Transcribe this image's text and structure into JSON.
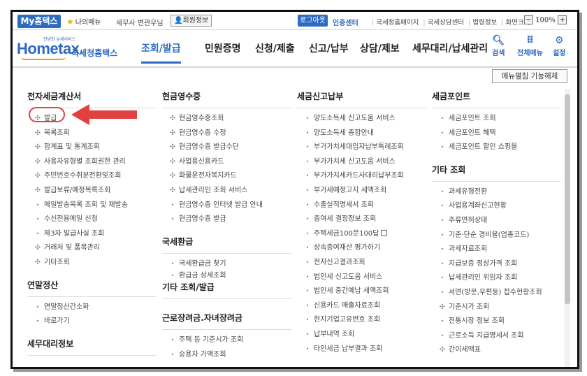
{
  "topbar": {
    "my_hometax": "My홈택스",
    "my_menu": "나의메뉴",
    "username": "세무사 변관우님",
    "member_info": "회원정보",
    "logout": "로그아웃",
    "cert_center": "인증센터",
    "links": [
      "국세청홈페이지",
      "국세상담센터",
      "법령정보",
      "화면크기"
    ],
    "zoom_minus": "−",
    "zoom_level": "100%",
    "zoom_plus": "+"
  },
  "logo": {
    "text": "Hometax.",
    "sub": "국세청홈택스",
    "tiny": "안녕한 납세서비스"
  },
  "nav": {
    "items": [
      "조회/발급",
      "민원증명",
      "신청/제출",
      "신고/납부",
      "상담/제보",
      "세무대리/납세관리"
    ],
    "active_index": 0
  },
  "util": {
    "search": "검색",
    "all_menu": "전체메뉴",
    "settings": "설정"
  },
  "menu_toggle": "메뉴펼침 기능해제",
  "columns": [
    {
      "sections": [
        {
          "title": "전자세금계산서",
          "items": [
            {
              "label": "발급",
              "mark": "✣"
            },
            {
              "label": "목록조회",
              "mark": "✣"
            },
            {
              "label": "합계표 및 통계조회",
              "mark": "✣"
            },
            {
              "label": "사용자유형별 조회권한 관리",
              "mark": "✣"
            },
            {
              "label": "주민번호수취분전환및조회",
              "mark": "✣"
            },
            {
              "label": "발급보류/예정목록조회",
              "mark": "✣"
            },
            {
              "label": "메일발송목록 조회 및 재발송",
              "mark": "•"
            },
            {
              "label": "수신전용메일 신청",
              "mark": "•"
            },
            {
              "label": "제3자 발급사실 조회",
              "mark": "•"
            },
            {
              "label": "거래처 및 품목관리",
              "mark": "✣"
            },
            {
              "label": "기타조회",
              "mark": "✣"
            }
          ]
        },
        {
          "title": "연말정산",
          "items": [
            {
              "label": "연말정산간소화",
              "mark": "•"
            },
            {
              "label": "바로가기",
              "mark": "•"
            }
          ]
        },
        {
          "title": "세무대리정보",
          "items": []
        }
      ]
    },
    {
      "sections": [
        {
          "title": "현금영수증",
          "items": [
            {
              "label": "현금영수증조회",
              "mark": "✣"
            },
            {
              "label": "현금영수증 수정",
              "mark": "✣"
            },
            {
              "label": "현금영수증 발급수단",
              "mark": "✣"
            },
            {
              "label": "사업용신용카드",
              "mark": "✣"
            },
            {
              "label": "화물운전자복지카드",
              "mark": "✣"
            },
            {
              "label": "납세관리인 조회 서비스",
              "mark": "✣"
            },
            {
              "label": "현금영수증 인터넷 발급 안내",
              "mark": "•"
            },
            {
              "label": "현금영수증 발급",
              "mark": "•"
            }
          ]
        },
        {
          "title": "국세환급",
          "items": [
            {
              "label": "국세환급금 찾기",
              "mark": "•"
            },
            {
              "label": "환급금 상세조회",
              "mark": "•"
            }
          ]
        },
        {
          "title": "기타 조회/발급",
          "items": []
        },
        {
          "title": "근로장려금.자녀장려금",
          "items": [
            {
              "label": "주택 등 기준시가 조회",
              "mark": "•"
            },
            {
              "label": "승용차 가액조회",
              "mark": "•"
            }
          ]
        }
      ]
    },
    {
      "sections": [
        {
          "title": "세금신고납부",
          "items": [
            {
              "label": "양도소득세 신고도움 서비스",
              "mark": "•"
            },
            {
              "label": "양도소득세 종합안내",
              "mark": "•"
            },
            {
              "label": "부가가치세대입자납부특례조회",
              "mark": "•"
            },
            {
              "label": "부가가치세 신고도움 서비스",
              "mark": "•"
            },
            {
              "label": "부가가치세카드사대리납부조회",
              "mark": "•"
            },
            {
              "label": "부가세예정고지 세액조회",
              "mark": "•"
            },
            {
              "label": "수출실적명세서 조회",
              "mark": "•"
            },
            {
              "label": "증여세 결정정보 조회",
              "mark": "•"
            },
            {
              "label": "주택세금100문100답",
              "mark": "•",
              "ext": true
            },
            {
              "label": "상속증여재산 평가하기",
              "mark": "•"
            },
            {
              "label": "전자신고결과조회",
              "mark": "•"
            },
            {
              "label": "법인세 신고도움 서비스",
              "mark": "•"
            },
            {
              "label": "법인세 중간예납 세액조회",
              "mark": "•"
            },
            {
              "label": "신용카드 매출자료조회",
              "mark": "•"
            },
            {
              "label": "현지기업고유번호 조회",
              "mark": "•"
            },
            {
              "label": "납부내역 조회",
              "mark": "•"
            },
            {
              "label": "타인세금 납부결과 조회",
              "mark": "•"
            }
          ]
        }
      ]
    },
    {
      "sections": [
        {
          "title": "세금포인트",
          "items": [
            {
              "label": "세금포인트 조회",
              "mark": "•"
            },
            {
              "label": "세금포인트 혜택",
              "mark": "•"
            },
            {
              "label": "세금포인트 할인 쇼핑몰",
              "mark": "•"
            }
          ]
        },
        {
          "title": "기타 조회",
          "items": [
            {
              "label": "과세유형전환",
              "mark": "•"
            },
            {
              "label": "사업용계좌신고현황",
              "mark": "•"
            },
            {
              "label": "주류면허상태",
              "mark": "•"
            },
            {
              "label": "기준·단순 경비율(업종코드)",
              "mark": "•"
            },
            {
              "label": "과세자료조회",
              "mark": "•"
            },
            {
              "label": "지급보증 정상가격 조회",
              "mark": "•"
            },
            {
              "label": "납세관리인 위임자 조회",
              "mark": "•"
            },
            {
              "label": "서면(방문,우편등) 접수현황조회",
              "mark": "•"
            },
            {
              "label": "기준시가 조회",
              "mark": "✣"
            },
            {
              "label": "전통시장 정보 조회",
              "mark": "•"
            },
            {
              "label": "근로소득 지급명세서 조회",
              "mark": "•"
            },
            {
              "label": "간이세액표",
              "mark": "✣"
            }
          ]
        }
      ]
    }
  ],
  "colors": {
    "brand": "#2d6ac2",
    "highlight": "#e24040",
    "logo_swoosh": "#f29b1e"
  }
}
